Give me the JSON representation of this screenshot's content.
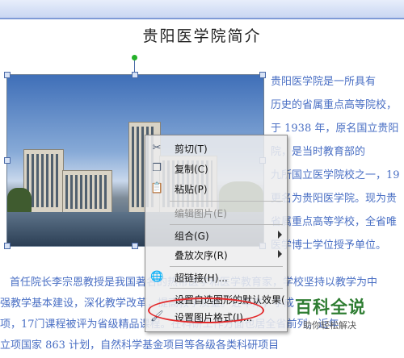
{
  "document": {
    "title": "贵阳医学院简介",
    "right_lines": [
      "贵阳医学院是一所具有",
      "历史的省属重点高等院校，",
      "于 1938 年，原名国立贵阳",
      "院，是当时教育部的",
      "九所国立医学院校之一，19",
      "更名为贵阳医学院。现为贵",
      "省属重点高等学校，全省唯",
      "医学博士学位授予单位。"
    ],
    "bottom_lines": [
      "首任院长李宗恩教授是我国著名的热带医学和医学教育家，学校坚持以教学为中",
      "强教学基本建设，深化教学改革，提高教学质量。近年来，学成",
      "项，17门课程被评为省级精品课程。在科研工作方面也居全省前列。近年",
      "立项国家 863 计划，自然科学基金项目等各级各类科研项目"
    ]
  },
  "context_menu": {
    "items": [
      {
        "label": "剪切(T)",
        "icon": "scissors-icon",
        "glyph": "✂",
        "enabled": true
      },
      {
        "label": "复制(C)",
        "icon": "copy-icon",
        "glyph": "❐",
        "enabled": true
      },
      {
        "label": "粘贴(P)",
        "icon": "paste-icon",
        "glyph": "📋",
        "enabled": true
      },
      {
        "label": "编辑图片(E)",
        "icon": "",
        "glyph": "",
        "enabled": false
      },
      {
        "label": "组合(G)",
        "icon": "",
        "glyph": "",
        "enabled": true,
        "submenu": true
      },
      {
        "label": "叠放次序(R)",
        "icon": "",
        "glyph": "",
        "enabled": true,
        "submenu": true
      },
      {
        "label": "超链接(H)...",
        "icon": "hyperlink-icon",
        "glyph": "🌐",
        "enabled": true
      },
      {
        "label": "设置自选图形的默认效果(",
        "icon": "",
        "glyph": "",
        "enabled": true
      },
      {
        "label": "设置图片格式(I)...",
        "icon": "format-picture-icon",
        "glyph": "🖌",
        "enabled": true
      }
    ]
  },
  "watermark": {
    "title": "百科全说",
    "subtitle": "助你轻松解决"
  },
  "colors": {
    "body_text": "#4a6fc4",
    "highlight_oval": "#e2282a",
    "watermark_green": "#2e7d32"
  }
}
